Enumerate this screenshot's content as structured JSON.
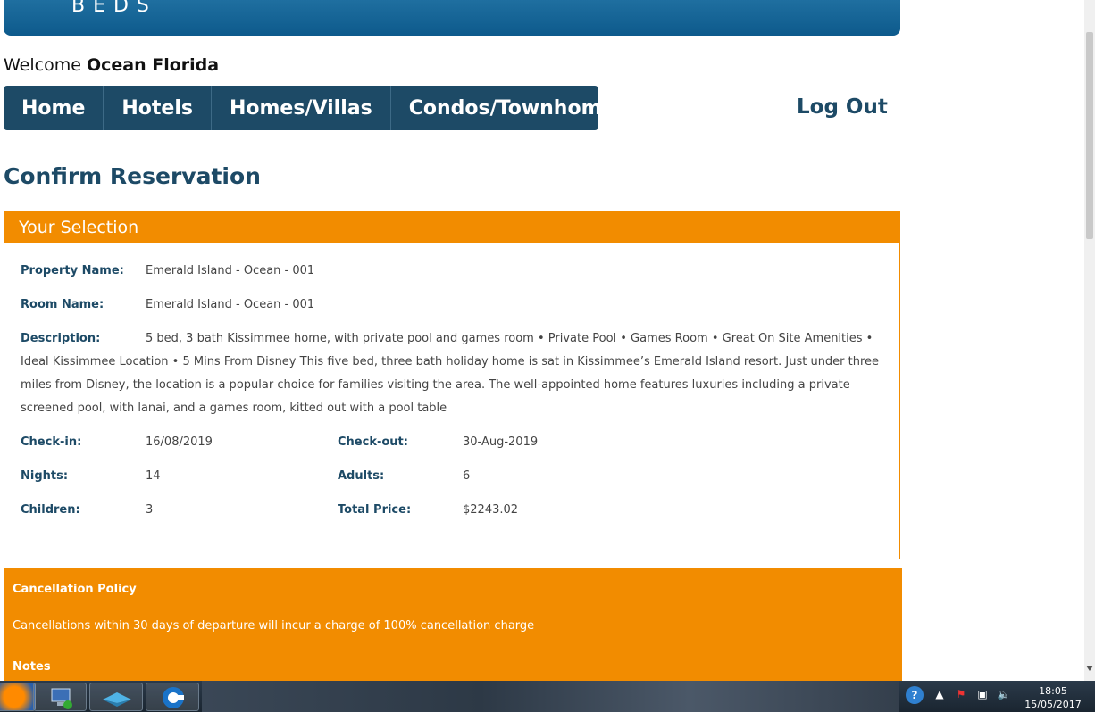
{
  "banner": {
    "logo_text": "BEDS"
  },
  "welcome": {
    "prefix": "Welcome ",
    "name": "Ocean Florida"
  },
  "nav": {
    "items": [
      {
        "label": "Home"
      },
      {
        "label": "Hotels"
      },
      {
        "label": "Homes/Villas"
      },
      {
        "label": "Condos/Townhomes"
      }
    ],
    "logout": "Log Out"
  },
  "page_title": "Confirm Reservation",
  "selection": {
    "header": "Your Selection",
    "property_name_label": "Property Name:",
    "property_name": "Emerald Island - Ocean - 001",
    "room_name_label": "Room Name:",
    "room_name": "Emerald Island - Ocean - 001",
    "description_label": "Description:",
    "description": "5 bed, 3 bath Kissimmee home, with private pool and games room • Private Pool • Games Room • Great On Site Amenities • Ideal Kissimmee Location • 5 Mins From Disney This five bed, three bath holiday home is sat in Kissimmee’s Emerald Island resort. Just under three miles from Disney, the location is a popular choice for families visiting the area. The well-appointed home features luxuries including a private screened pool, with lanai, and a games room, kitted out with a pool table",
    "checkin_label": "Check-in:",
    "checkin": "16/08/2019",
    "checkout_label": "Check-out:",
    "checkout": "30-Aug-2019",
    "nights_label": "Nights:",
    "nights": "14",
    "adults_label": "Adults:",
    "adults": "6",
    "children_label": "Children:",
    "children": "3",
    "total_price_label": "Total Price:",
    "total_price": "$2243.02"
  },
  "policy": {
    "title": "Cancellation Policy",
    "text": "Cancellations within 30 days of departure will incur a charge of 100% cancellation charge",
    "notes_title": "Notes"
  },
  "taskbar": {
    "icons": [
      "firefox-icon",
      "network-computer-icon",
      "app-icon",
      "chrome-icon"
    ],
    "tray_icons": [
      "help-icon",
      "show-hidden-icon",
      "flag-icon",
      "network-icon",
      "volume-icon"
    ],
    "time": "18:05",
    "date": "15/05/2017"
  }
}
